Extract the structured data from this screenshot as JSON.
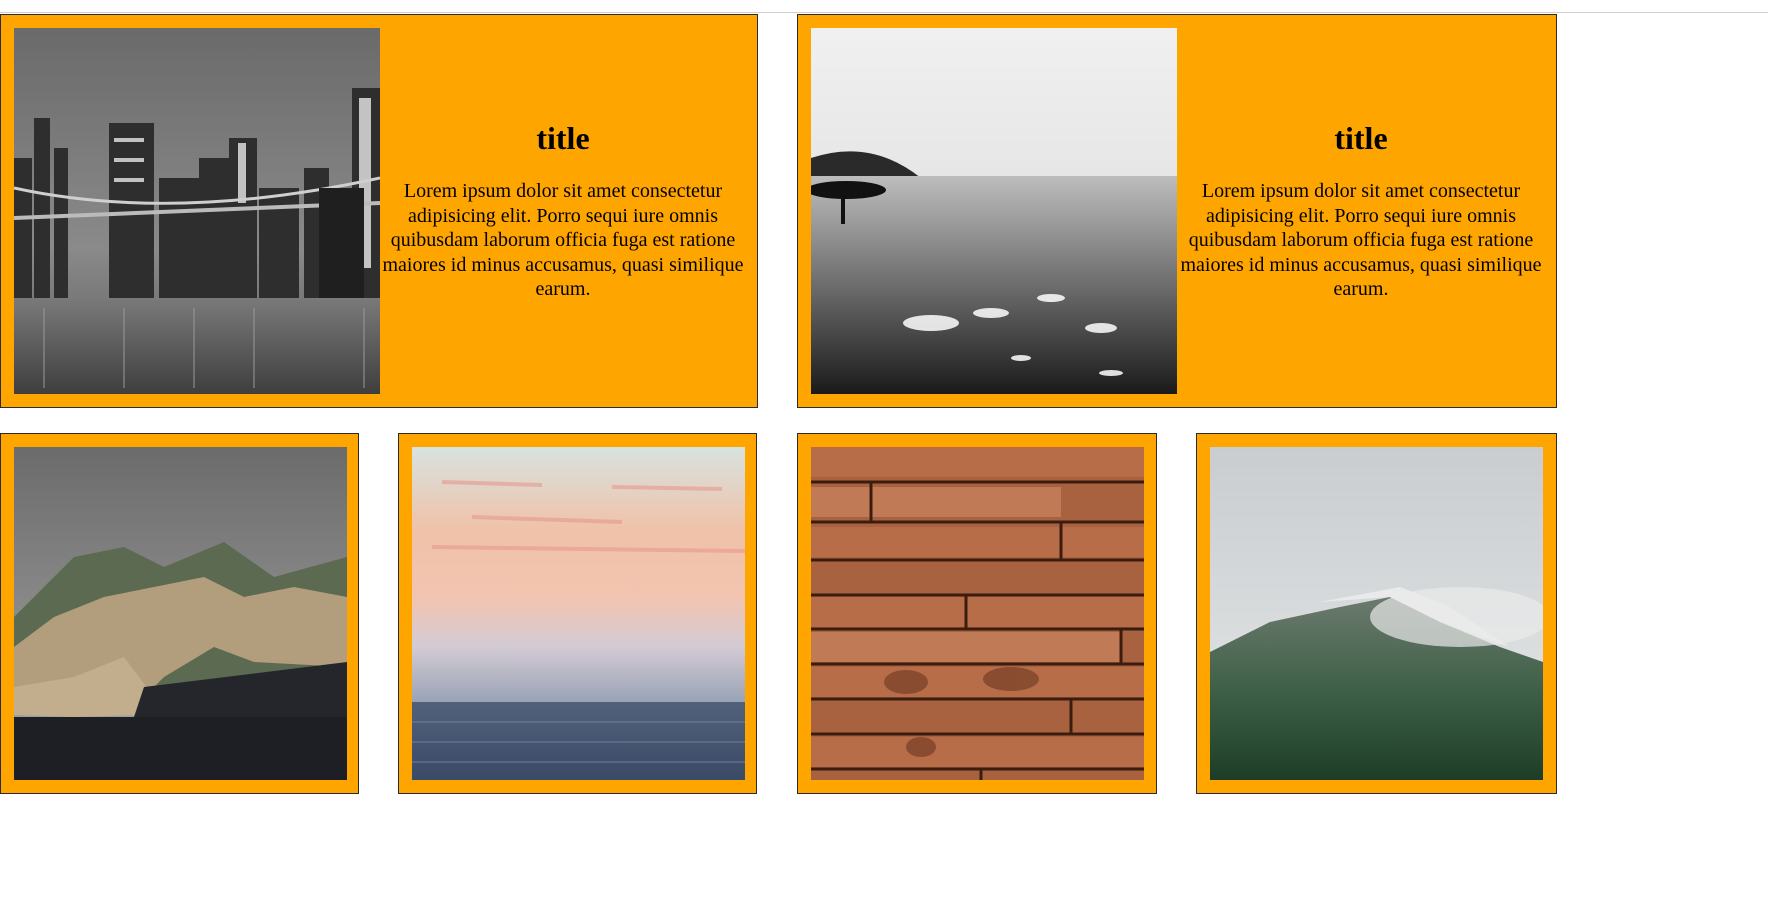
{
  "cards": [
    {
      "title": "title",
      "text": "Lorem ipsum dolor sit amet consectetur adipisicing elit. Porro sequi iure omnis quibusdam laborum officia fuga est ratione maiores id minus accusamus, quasi similique earum.",
      "image": "bridge-city-night-photo"
    },
    {
      "title": "title",
      "text": "Lorem ipsum dolor sit amet consectetur adipisicing elit. Porro sequi iure omnis quibusdam laborum officia fuga est ratione maiores id minus accusamus, quasi similique earum.",
      "image": "surfer-beach-photo"
    }
  ],
  "tiles": [
    {
      "image": "coastal-cliffs-photo"
    },
    {
      "image": "foggy-sea-sunset-photo"
    },
    {
      "image": "wood-planks-photo"
    },
    {
      "image": "misty-mountain-photo"
    }
  ],
  "colors": {
    "card_background": "#ffa500",
    "card_border": "#2b2b2b"
  }
}
